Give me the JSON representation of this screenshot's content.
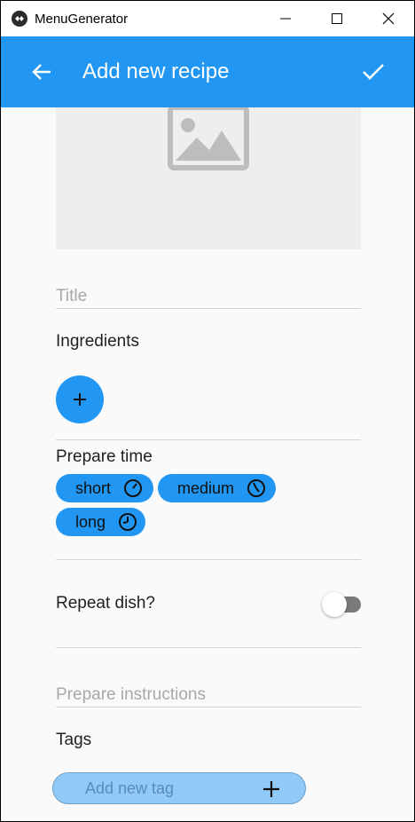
{
  "window": {
    "title": "MenuGenerator",
    "controls": [
      "minimize-icon",
      "maximize-icon",
      "close-icon"
    ]
  },
  "appbar": {
    "title": "Add new recipe",
    "back_icon": "arrow-left-icon",
    "confirm_icon": "check-icon",
    "color": "#2196f3"
  },
  "image": {
    "icon": "image-placeholder-icon"
  },
  "form": {
    "title_placeholder": "Title",
    "ingredients_label": "Ingredients",
    "add_ingredient_icon": "plus-icon",
    "prepare_time_label": "Prepare time",
    "prepare_time_chips": [
      {
        "label": "short",
        "icon": "clock-short-icon"
      },
      {
        "label": "medium",
        "icon": "clock-medium-icon"
      },
      {
        "label": "long",
        "icon": "clock-long-icon"
      }
    ],
    "repeat_label": "Repeat dish?",
    "repeat_on": false,
    "instructions_placeholder": "Prepare instructions",
    "tags_label": "Tags",
    "tag_input_placeholder": "Add new tag",
    "tag_add_icon": "plus-icon"
  }
}
